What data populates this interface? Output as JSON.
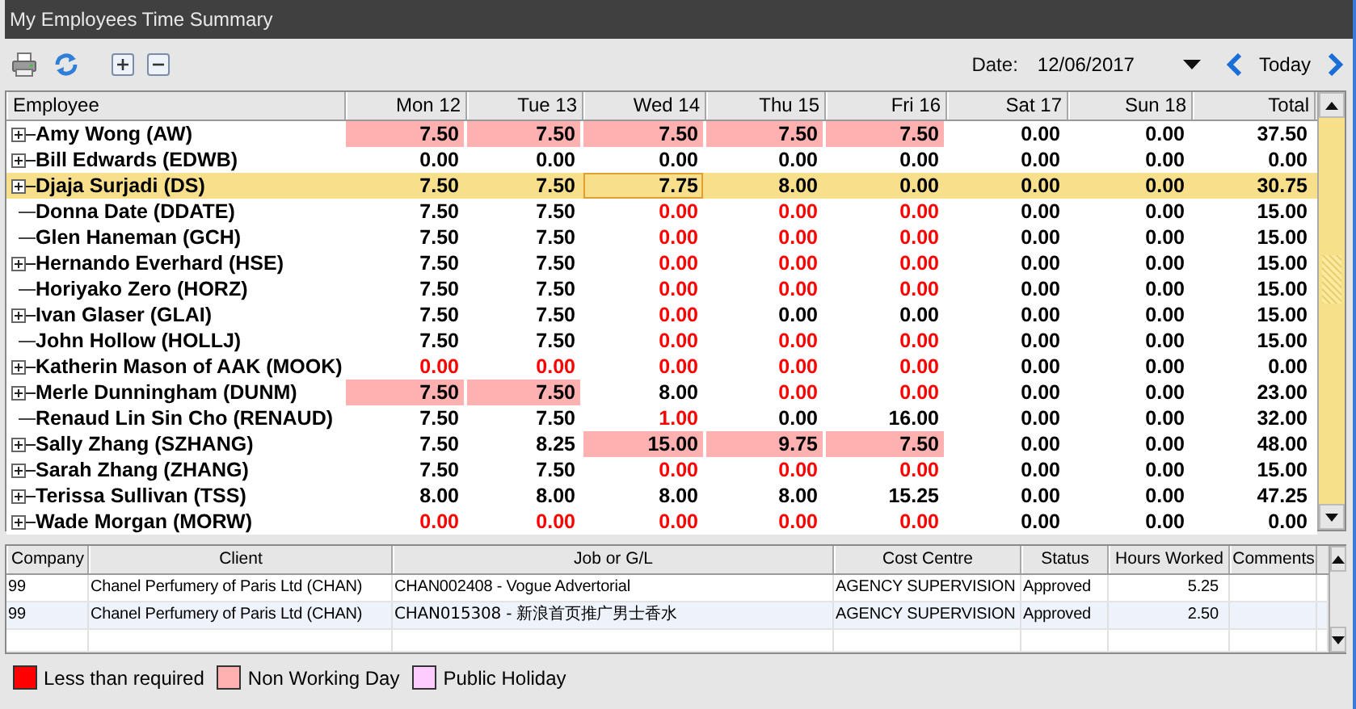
{
  "window": {
    "title": "My Employees Time Summary"
  },
  "toolbar": {
    "date_label": "Date:",
    "date_value": "12/06/2017",
    "today": "Today"
  },
  "grid": {
    "employee_column": "Employee",
    "value_columns": [
      "Mon 12",
      "Tue 13",
      "Wed 14",
      "Thu 15",
      "Fri 16",
      "Sat 17",
      "Sun 18",
      "Total"
    ],
    "rows": [
      {
        "name": "Amy Wong (AW)",
        "expandable": true,
        "selected": false,
        "cells": [
          {
            "v": "7.50",
            "non_working_day": true
          },
          {
            "v": "7.50",
            "non_working_day": true
          },
          {
            "v": "7.50",
            "non_working_day": true
          },
          {
            "v": "7.50",
            "non_working_day": true
          },
          {
            "v": "7.50",
            "non_working_day": true
          },
          {
            "v": "0.00"
          },
          {
            "v": "0.00"
          },
          {
            "v": "37.50"
          }
        ]
      },
      {
        "name": "Bill Edwards (EDWB)",
        "expandable": true,
        "selected": false,
        "cells": [
          {
            "v": "0.00"
          },
          {
            "v": "0.00"
          },
          {
            "v": "0.00"
          },
          {
            "v": "0.00"
          },
          {
            "v": "0.00"
          },
          {
            "v": "0.00"
          },
          {
            "v": "0.00"
          },
          {
            "v": "0.00"
          }
        ]
      },
      {
        "name": "Djaja Surjadi (DS)",
        "expandable": true,
        "selected": true,
        "cells": [
          {
            "v": "7.50"
          },
          {
            "v": "7.50"
          },
          {
            "v": "7.75",
            "focused": true
          },
          {
            "v": "8.00"
          },
          {
            "v": "0.00"
          },
          {
            "v": "0.00"
          },
          {
            "v": "0.00"
          },
          {
            "v": "30.75"
          }
        ]
      },
      {
        "name": "Donna Date (DDATE)",
        "expandable": false,
        "selected": false,
        "cells": [
          {
            "v": "7.50"
          },
          {
            "v": "7.50"
          },
          {
            "v": "0.00",
            "below_required": true
          },
          {
            "v": "0.00",
            "below_required": true
          },
          {
            "v": "0.00",
            "below_required": true
          },
          {
            "v": "0.00"
          },
          {
            "v": "0.00"
          },
          {
            "v": "15.00"
          }
        ]
      },
      {
        "name": "Glen Haneman (GCH)",
        "expandable": false,
        "selected": false,
        "cells": [
          {
            "v": "7.50"
          },
          {
            "v": "7.50"
          },
          {
            "v": "0.00",
            "below_required": true
          },
          {
            "v": "0.00",
            "below_required": true
          },
          {
            "v": "0.00",
            "below_required": true
          },
          {
            "v": "0.00"
          },
          {
            "v": "0.00"
          },
          {
            "v": "15.00"
          }
        ]
      },
      {
        "name": "Hernando Everhard (HSE)",
        "expandable": true,
        "selected": false,
        "cells": [
          {
            "v": "7.50"
          },
          {
            "v": "7.50"
          },
          {
            "v": "0.00",
            "below_required": true
          },
          {
            "v": "0.00",
            "below_required": true
          },
          {
            "v": "0.00",
            "below_required": true
          },
          {
            "v": "0.00"
          },
          {
            "v": "0.00"
          },
          {
            "v": "15.00"
          }
        ]
      },
      {
        "name": "Horiyako Zero (HORZ)",
        "expandable": false,
        "selected": false,
        "cells": [
          {
            "v": "7.50"
          },
          {
            "v": "7.50"
          },
          {
            "v": "0.00",
            "below_required": true
          },
          {
            "v": "0.00",
            "below_required": true
          },
          {
            "v": "0.00",
            "below_required": true
          },
          {
            "v": "0.00"
          },
          {
            "v": "0.00"
          },
          {
            "v": "15.00"
          }
        ]
      },
      {
        "name": "Ivan Glaser (GLAI)",
        "expandable": true,
        "selected": false,
        "cells": [
          {
            "v": "7.50"
          },
          {
            "v": "7.50"
          },
          {
            "v": "0.00",
            "below_required": true
          },
          {
            "v": "0.00"
          },
          {
            "v": "0.00"
          },
          {
            "v": "0.00"
          },
          {
            "v": "0.00"
          },
          {
            "v": "15.00"
          }
        ]
      },
      {
        "name": "John Hollow (HOLLJ)",
        "expandable": false,
        "selected": false,
        "cells": [
          {
            "v": "7.50"
          },
          {
            "v": "7.50"
          },
          {
            "v": "0.00",
            "below_required": true
          },
          {
            "v": "0.00",
            "below_required": true
          },
          {
            "v": "0.00",
            "below_required": true
          },
          {
            "v": "0.00"
          },
          {
            "v": "0.00"
          },
          {
            "v": "15.00"
          }
        ]
      },
      {
        "name": "Katherin Mason of AAK (MOOK)",
        "expandable": true,
        "selected": false,
        "cells": [
          {
            "v": "0.00",
            "below_required": true
          },
          {
            "v": "0.00",
            "below_required": true
          },
          {
            "v": "0.00",
            "below_required": true
          },
          {
            "v": "0.00",
            "below_required": true
          },
          {
            "v": "0.00",
            "below_required": true
          },
          {
            "v": "0.00"
          },
          {
            "v": "0.00"
          },
          {
            "v": "0.00"
          }
        ]
      },
      {
        "name": "Merle Dunningham (DUNM)",
        "expandable": true,
        "selected": false,
        "cells": [
          {
            "v": "7.50",
            "non_working_day": true
          },
          {
            "v": "7.50",
            "non_working_day": true
          },
          {
            "v": "8.00"
          },
          {
            "v": "0.00",
            "below_required": true
          },
          {
            "v": "0.00",
            "below_required": true
          },
          {
            "v": "0.00"
          },
          {
            "v": "0.00"
          },
          {
            "v": "23.00"
          }
        ]
      },
      {
        "name": "Renaud Lin Sin Cho (RENAUD)",
        "expandable": false,
        "selected": false,
        "cells": [
          {
            "v": "7.50"
          },
          {
            "v": "7.50"
          },
          {
            "v": "1.00",
            "below_required": true
          },
          {
            "v": "0.00"
          },
          {
            "v": "16.00"
          },
          {
            "v": "0.00"
          },
          {
            "v": "0.00"
          },
          {
            "v": "32.00"
          }
        ]
      },
      {
        "name": "Sally Zhang (SZHANG)",
        "expandable": true,
        "selected": false,
        "cells": [
          {
            "v": "7.50"
          },
          {
            "v": "8.25"
          },
          {
            "v": "15.00",
            "non_working_day": true
          },
          {
            "v": "9.75",
            "non_working_day": true
          },
          {
            "v": "7.50",
            "non_working_day": true
          },
          {
            "v": "0.00"
          },
          {
            "v": "0.00"
          },
          {
            "v": "48.00"
          }
        ]
      },
      {
        "name": "Sarah Zhang (ZHANG)",
        "expandable": true,
        "selected": false,
        "cells": [
          {
            "v": "7.50"
          },
          {
            "v": "7.50"
          },
          {
            "v": "0.00",
            "below_required": true
          },
          {
            "v": "0.00",
            "below_required": true
          },
          {
            "v": "0.00",
            "below_required": true
          },
          {
            "v": "0.00"
          },
          {
            "v": "0.00"
          },
          {
            "v": "15.00"
          }
        ]
      },
      {
        "name": "Terissa Sullivan (TSS)",
        "expandable": true,
        "selected": false,
        "cells": [
          {
            "v": "8.00"
          },
          {
            "v": "8.00"
          },
          {
            "v": "8.00"
          },
          {
            "v": "8.00"
          },
          {
            "v": "15.25"
          },
          {
            "v": "0.00"
          },
          {
            "v": "0.00"
          },
          {
            "v": "47.25"
          }
        ]
      },
      {
        "name": "Wade Morgan (MORW)",
        "expandable": true,
        "selected": false,
        "cells": [
          {
            "v": "0.00",
            "below_required": true
          },
          {
            "v": "0.00",
            "below_required": true
          },
          {
            "v": "0.00",
            "below_required": true
          },
          {
            "v": "0.00",
            "below_required": true
          },
          {
            "v": "0.00",
            "below_required": true
          },
          {
            "v": "0.00"
          },
          {
            "v": "0.00"
          },
          {
            "v": "0.00"
          }
        ]
      }
    ]
  },
  "details": {
    "columns": [
      "Company",
      "Client",
      "Job or G/L",
      "Cost Centre",
      "Status",
      "Hours Worked",
      "Comments"
    ],
    "rows": [
      {
        "company": "99",
        "client": "Chanel Perfumery of Paris Ltd (CHAN)",
        "job": "CHAN002408 - Vogue Advertorial",
        "cost_centre": "AGENCY SUPERVISION",
        "status": "Approved",
        "hours": "5.25"
      },
      {
        "company": "99",
        "client": "Chanel Perfumery of Paris Ltd (CHAN)",
        "job": "CHAN015308 - 新浪首页推广男士香水",
        "cost_centre": "AGENCY SUPERVISION",
        "status": "Approved",
        "hours": "2.50"
      }
    ]
  },
  "legend": [
    {
      "label": "Less than required",
      "color": "#ff0000"
    },
    {
      "label": "Non Working Day",
      "color": "#ffb0b0"
    },
    {
      "label": "Public Holiday",
      "color": "#ffccff"
    }
  ]
}
